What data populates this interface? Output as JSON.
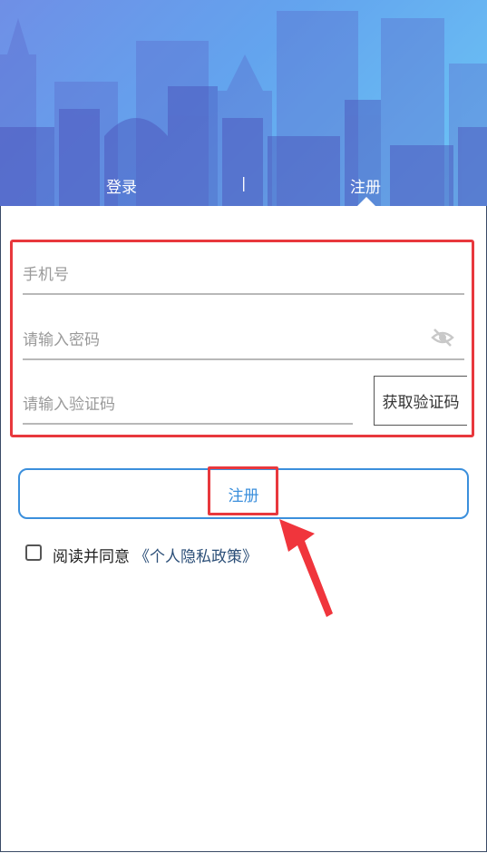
{
  "tabs": {
    "login_label": "登录",
    "separator": "|",
    "register_label": "注册",
    "active": "register"
  },
  "form": {
    "phone_placeholder": "手机号",
    "password_placeholder": "请输入密码",
    "code_placeholder": "请输入验证码",
    "get_code_label": "获取验证码",
    "password_toggle_icon": "eye-off-icon"
  },
  "register_button": {
    "label": "注册"
  },
  "agreement": {
    "prefix": "阅读并同意",
    "link": "《个人隐私政策》",
    "checked": false
  },
  "colors": {
    "header_start": "#6f8fe6",
    "header_end": "#6cc7f6",
    "accent_blue": "#3b8fdc",
    "highlight_red": "#e8383d",
    "arrow_red": "#f0353c",
    "link_color": "#2c4f78"
  }
}
